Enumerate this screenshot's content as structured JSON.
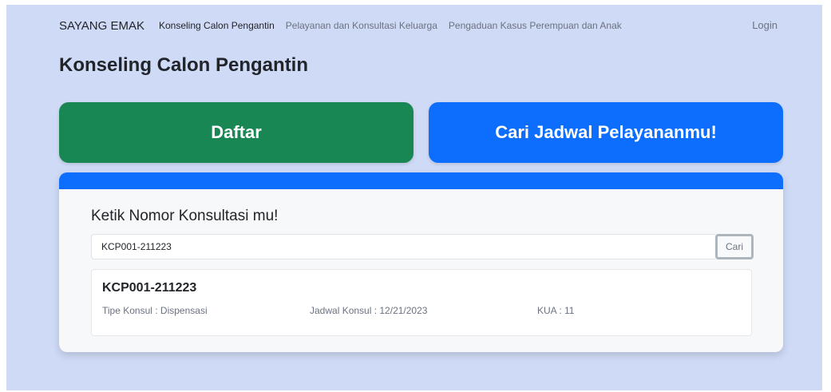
{
  "navbar": {
    "brand": "SAYANG EMAK",
    "links": [
      "Konseling Calon Pengantin",
      "Pelayanan dan Konsultasi Keluarga",
      "Pengaduan Kasus Perempuan dan Anak"
    ],
    "login": "Login"
  },
  "page": {
    "title": "Konseling Calon Pengantin"
  },
  "buttons": {
    "daftar": "Daftar",
    "cari_jadwal": "Cari Jadwal Pelayananmu!"
  },
  "search": {
    "title": "Ketik Nomor Konsultasi mu!",
    "value": "KCP001-211223",
    "button": "Cari"
  },
  "result": {
    "code": "KCP001-211223",
    "tipe": "Tipe Konsul : Dispensasi",
    "jadwal": "Jadwal Konsul : 12/21/2023",
    "kua": "KUA : 11"
  },
  "colors": {
    "background": "#cfdaf6",
    "success": "#198754",
    "primary": "#0d6efd"
  }
}
